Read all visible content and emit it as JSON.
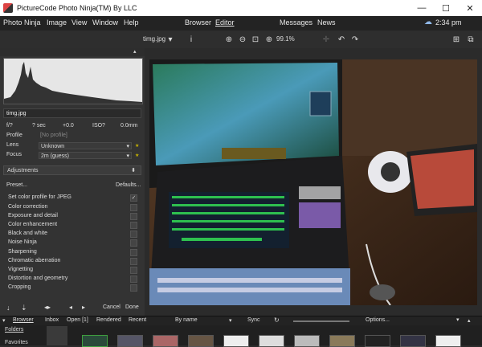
{
  "window": {
    "title": "PictureCode Photo Ninja(TM) By LLC",
    "minimize": "—",
    "maximize": "☐",
    "close": "✕"
  },
  "menu": {
    "items": [
      "Photo Ninja",
      "Image",
      "View",
      "Window",
      "Help"
    ],
    "browser": "Browser",
    "editor": "Editor",
    "messages": "Messages",
    "news": "News",
    "clock": "2:34 pm"
  },
  "toolbar": {
    "filename": "timg.jpg",
    "zoom": "99.1%"
  },
  "left": {
    "filename": "timg.jpg",
    "exposure": {
      "aperture": "f/?",
      "shutter": "? sec",
      "ev": "+0.0",
      "iso": "ISO?",
      "focal": "0.0mm"
    },
    "profile_label": "Profile",
    "profile_value": "[No profile]",
    "lens_label": "Lens",
    "lens_value": "Unknown",
    "focus_label": "Focus",
    "focus_value": "2m (guess)",
    "adjustments_label": "Adjustments",
    "preset_label": "Preset...",
    "defaults_label": "Defaults...",
    "adjustments": [
      "Set color profile for JPEG",
      "Color correction",
      "Exposure and detail",
      "Color enhancement",
      "Black and white",
      "Noise Ninja",
      "Sharpening",
      "Chromatic aberration",
      "Vignetting",
      "Distortion and geometry",
      "Cropping"
    ],
    "cancel": "Cancel",
    "done": "Done"
  },
  "bottom": {
    "browser": "Browser",
    "inbox": "Inbox",
    "open": "Open [1]",
    "rendered": "Rendered",
    "recent": "Recent",
    "sort": "By name",
    "sync": "Sync",
    "options": "Options...",
    "folders": "Folders",
    "favorites": "Favorites"
  },
  "colors": {
    "accent": "#d0b000",
    "panel": "#333333",
    "background": "#2b2b2b"
  }
}
